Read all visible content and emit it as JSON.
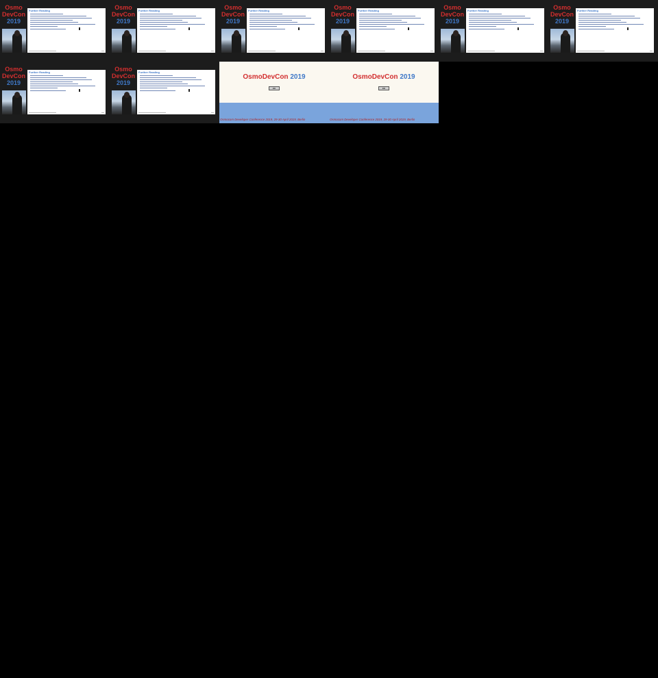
{
  "talk_slide": {
    "logo_osmo": "Osmo",
    "logo_devcon": "DevCon",
    "logo_year": "2019",
    "slide_title": "Further Reading"
  },
  "end_card": {
    "brand_osmo": "Osmo",
    "brand_devcon": "DevCon",
    "brand_year": "2019",
    "license_badge": "cc",
    "caption": "Osmocom Developer Conference 2019, 29-30 April 2019, Berlin"
  },
  "colors": {
    "background": "#000000",
    "talk_frame": "#1c1c1c",
    "logo_red": "#d22f2f",
    "logo_blue": "#3f78c8",
    "endcard_bg": "#fbf8f0",
    "endcard_band": "#7aa4dc"
  },
  "icons": {
    "license": "creative-commons-icon"
  }
}
